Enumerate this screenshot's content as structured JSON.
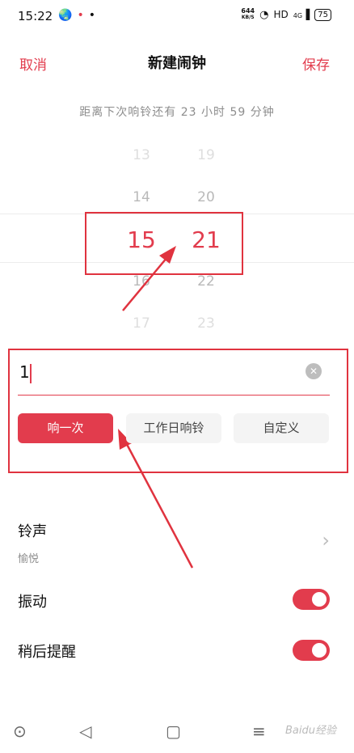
{
  "status_bar": {
    "time": "15:22",
    "icons": [
      "globe-icon",
      "pin-icon",
      "dot-icon"
    ],
    "net_speed_value": "644",
    "net_speed_unit": "KB/S",
    "hd": "HD",
    "signal": "4G",
    "battery": "75"
  },
  "header": {
    "cancel": "取消",
    "title": "新建闹钟",
    "save": "保存"
  },
  "countdown": "距离下次响铃还有 23 小时 59 分钟",
  "picker": {
    "hours": [
      "13",
      "14",
      "15",
      "16",
      "17"
    ],
    "minutes": [
      "19",
      "20",
      "21",
      "22",
      "23"
    ],
    "selected_hour": "15",
    "selected_minute": "21"
  },
  "label": {
    "value": "1"
  },
  "repeat_options": [
    "响一次",
    "工作日响铃",
    "自定义"
  ],
  "repeat_selected": "响一次",
  "ringtone": {
    "title": "铃声",
    "value": "愉悦"
  },
  "vibrate": {
    "title": "振动",
    "on": true
  },
  "snooze": {
    "title": "稍后提醒",
    "on": true
  },
  "watermark": "Baidu经验",
  "accent_color": "#e23c4d",
  "annotation_color": "#e0333f"
}
